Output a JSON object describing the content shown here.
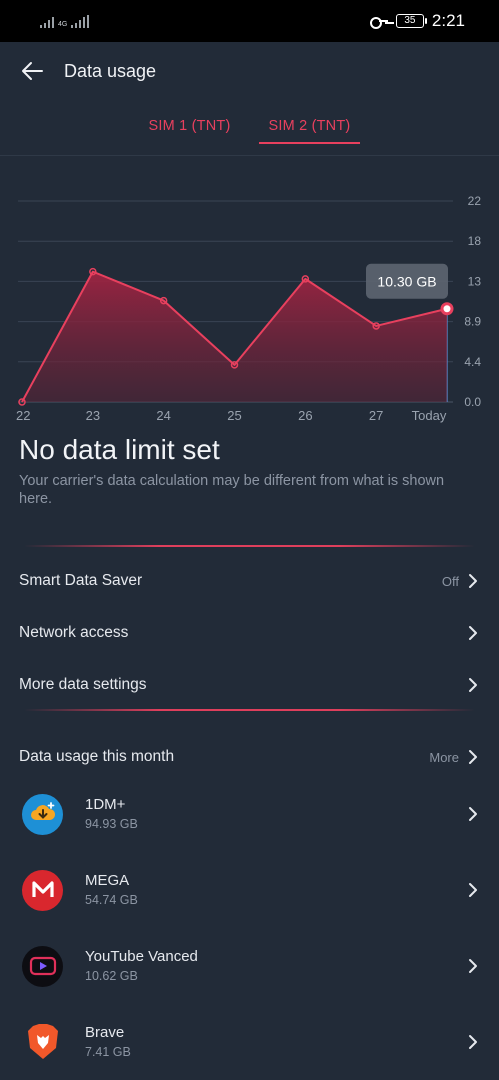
{
  "status_bar": {
    "network": "4G",
    "battery": "35",
    "time": "2:21"
  },
  "header": {
    "title": "Data usage"
  },
  "tabs": [
    {
      "label": "SIM 1 (TNT)",
      "active": false
    },
    {
      "label": "SIM 2 (TNT)",
      "active": true
    }
  ],
  "chart_data": {
    "type": "area",
    "categories": [
      "22",
      "23",
      "24",
      "25",
      "26",
      "27",
      "Today"
    ],
    "values": [
      0.0,
      14.4,
      11.2,
      4.1,
      13.6,
      8.4,
      10.3
    ],
    "y_ticks": [
      "22",
      "18",
      "13",
      "8.9",
      "4.4",
      "0.0"
    ],
    "ylim": [
      0,
      22.2
    ],
    "tooltip": "10.30 GB",
    "grid": true,
    "color": "#e8405e"
  },
  "limit": {
    "title": "No data limit set",
    "subtitle": "Your carrier's data calculation may be different from what is shown here."
  },
  "settings": {
    "smart_data_saver": {
      "label": "Smart Data Saver",
      "value": "Off"
    },
    "network_access": {
      "label": "Network access"
    },
    "more_data_settings": {
      "label": "More data settings"
    }
  },
  "usage": {
    "title": "Data usage this month",
    "more": "More",
    "apps": [
      {
        "name": "1DM+",
        "size": "94.93 GB"
      },
      {
        "name": "MEGA",
        "size": "54.74 GB"
      },
      {
        "name": "YouTube Vanced",
        "size": "10.62 GB"
      },
      {
        "name": "Brave",
        "size": "7.41 GB"
      }
    ]
  },
  "colors": {
    "background": "#222b38",
    "accent": "#e8405e",
    "muted_text": "#8c95a3"
  }
}
